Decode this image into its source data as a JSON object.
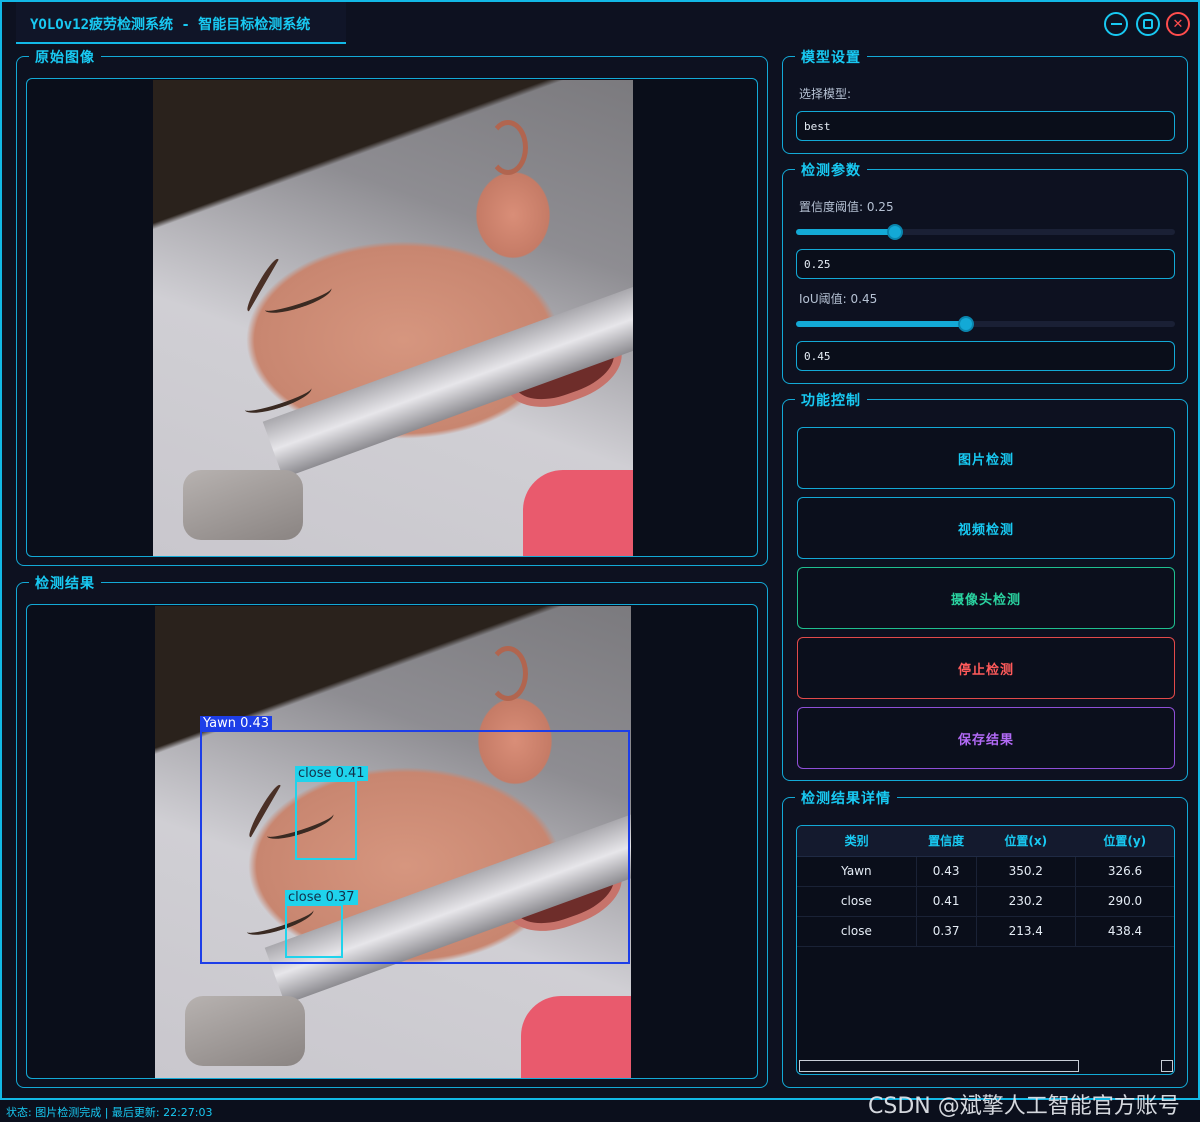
{
  "window": {
    "title": "YOLOv12疲劳检测系统 - 智能目标检测系统",
    "minimize_icon": "minimize-icon",
    "maximize_icon": "maximize-icon",
    "close_icon": "close-icon",
    "accent_color": "#12b8e6"
  },
  "original_panel": {
    "title": "原始图像"
  },
  "result_panel": {
    "title": "检测结果",
    "detections": [
      {
        "label": "Yawn 0.43"
      },
      {
        "label": "close 0.41"
      },
      {
        "label": "close 0.37"
      }
    ]
  },
  "model_settings": {
    "title": "模型设置",
    "select_label": "选择模型:",
    "selected_model": "best"
  },
  "params": {
    "title": "检测参数",
    "conf_label": "置信度阈值: 0.25",
    "conf_value": "0.25",
    "conf_level": 0.25,
    "iou_label": "IoU阈值: 0.45",
    "iou_value": "0.45",
    "iou_level": 0.45
  },
  "controls": {
    "title": "功能控制",
    "image_detect": "图片检测",
    "video_detect": "视频检测",
    "camera_detect": "摄像头检测",
    "stop_detect": "停止检测",
    "save_result": "保存结果"
  },
  "details": {
    "title": "检测结果详情",
    "columns": [
      "类别",
      "置信度",
      "位置(x)",
      "位置(y)"
    ],
    "rows": [
      [
        "Yawn",
        "0.43",
        "350.2",
        "326.6"
      ],
      [
        "close",
        "0.41",
        "230.2",
        "290.0"
      ],
      [
        "close",
        "0.37",
        "213.4",
        "438.4"
      ]
    ]
  },
  "status": {
    "text": "状态: 图片检测完成 | 最后更新: 22:27:03"
  },
  "watermark": "CSDN @斌擎人工智能官方账号"
}
